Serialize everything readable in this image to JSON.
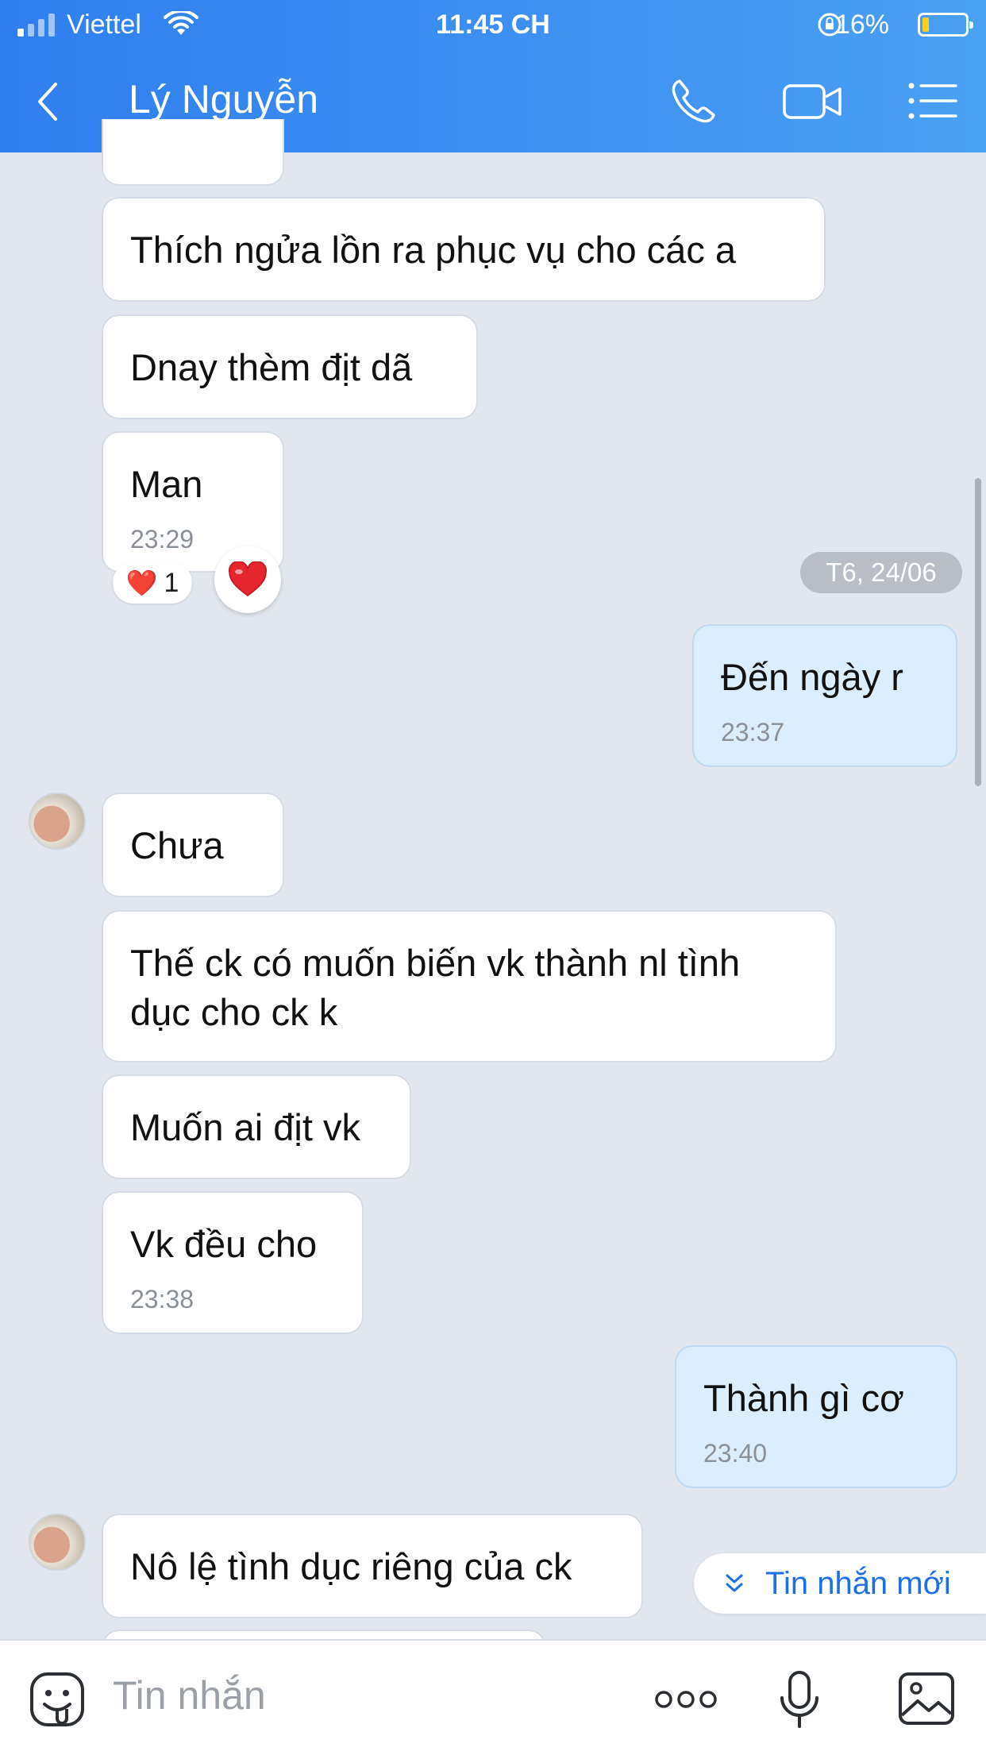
{
  "status_bar": {
    "carrier": "Viettel",
    "time": "11:45 CH",
    "battery": "16%",
    "battery_level": 0.16
  },
  "header": {
    "contact_name": "Lý Nguyễn",
    "icons": [
      "back-icon",
      "phone-icon",
      "video-icon",
      "menu-icon"
    ]
  },
  "messages": [
    {
      "side": "them",
      "text": "Thích ngửa lồn ra phục vụ cho các a"
    },
    {
      "side": "them",
      "text": "Dnay thèm địt dã"
    },
    {
      "side": "them",
      "text": "Man",
      "time": "23:29",
      "reaction": {
        "emoji": "❤️",
        "count": "1"
      }
    },
    {
      "side": "me",
      "text": "Đến ngày r",
      "time": "23:37"
    },
    {
      "side": "them",
      "text": "Chưa"
    },
    {
      "side": "them",
      "text": "Thế ck có muốn biến vk thành nl tình dục cho ck k"
    },
    {
      "side": "them",
      "text": "Muốn ai địt vk"
    },
    {
      "side": "them",
      "text": "Vk đều cho",
      "time": "23:38"
    },
    {
      "side": "me",
      "text": "Thành gì cơ",
      "time": "23:40"
    },
    {
      "side": "them",
      "text": "Nô lệ tình dục riêng của ck"
    }
  ],
  "date_separator": "T6, 24/06",
  "new_messages_button": "Tin nhắn mới",
  "composer": {
    "placeholder": "Tin nhắn",
    "icons": [
      "sticker-icon",
      "more-icon",
      "microphone-icon",
      "image-icon"
    ]
  },
  "colors": {
    "header_start": "#2f7ef0",
    "header_end": "#4aa0f2",
    "background": "#e2e7ef",
    "my_bubble": "#dbeefd",
    "their_bubble": "#ffffff",
    "accent": "#1d6fe3"
  }
}
